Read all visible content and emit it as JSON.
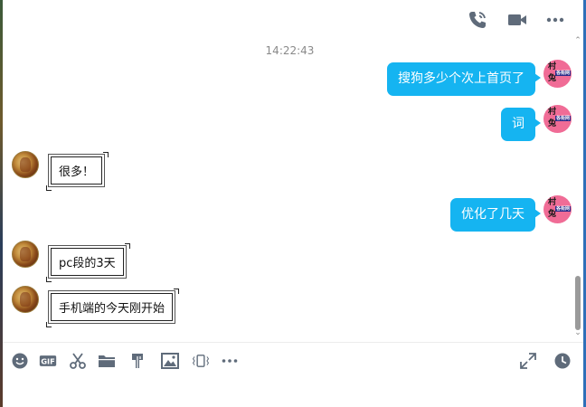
{
  "header": {
    "icons": [
      "phone-call-icon",
      "video-call-icon",
      "more-options-icon"
    ]
  },
  "messages": {
    "timestamp": "14:22:43",
    "items": [
      {
        "side": "right",
        "text": "搜狗多少个次上首页了"
      },
      {
        "side": "right",
        "text": "词"
      },
      {
        "side": "left",
        "text": "很多！"
      },
      {
        "side": "right",
        "text": "优化了几天"
      },
      {
        "side": "left",
        "text": "pc段的3天"
      },
      {
        "side": "left",
        "text": "手机端的今天刚开始"
      }
    ],
    "right_avatar": {
      "top": "村",
      "tag": "各街网",
      "bottom": "兔"
    }
  },
  "toolbar": {
    "gif_label": "GIF",
    "icons": [
      "emoji-icon",
      "gif-icon",
      "screenshot-scissors-icon",
      "folder-icon",
      "clipboard-icon",
      "image-icon",
      "shake-window-icon",
      "more-icon",
      "expand-icon",
      "history-icon"
    ]
  },
  "colors": {
    "bubble_right": "#15b4f1",
    "avatar_right": "#f06c96",
    "icon_gray": "#5f6b7a"
  }
}
